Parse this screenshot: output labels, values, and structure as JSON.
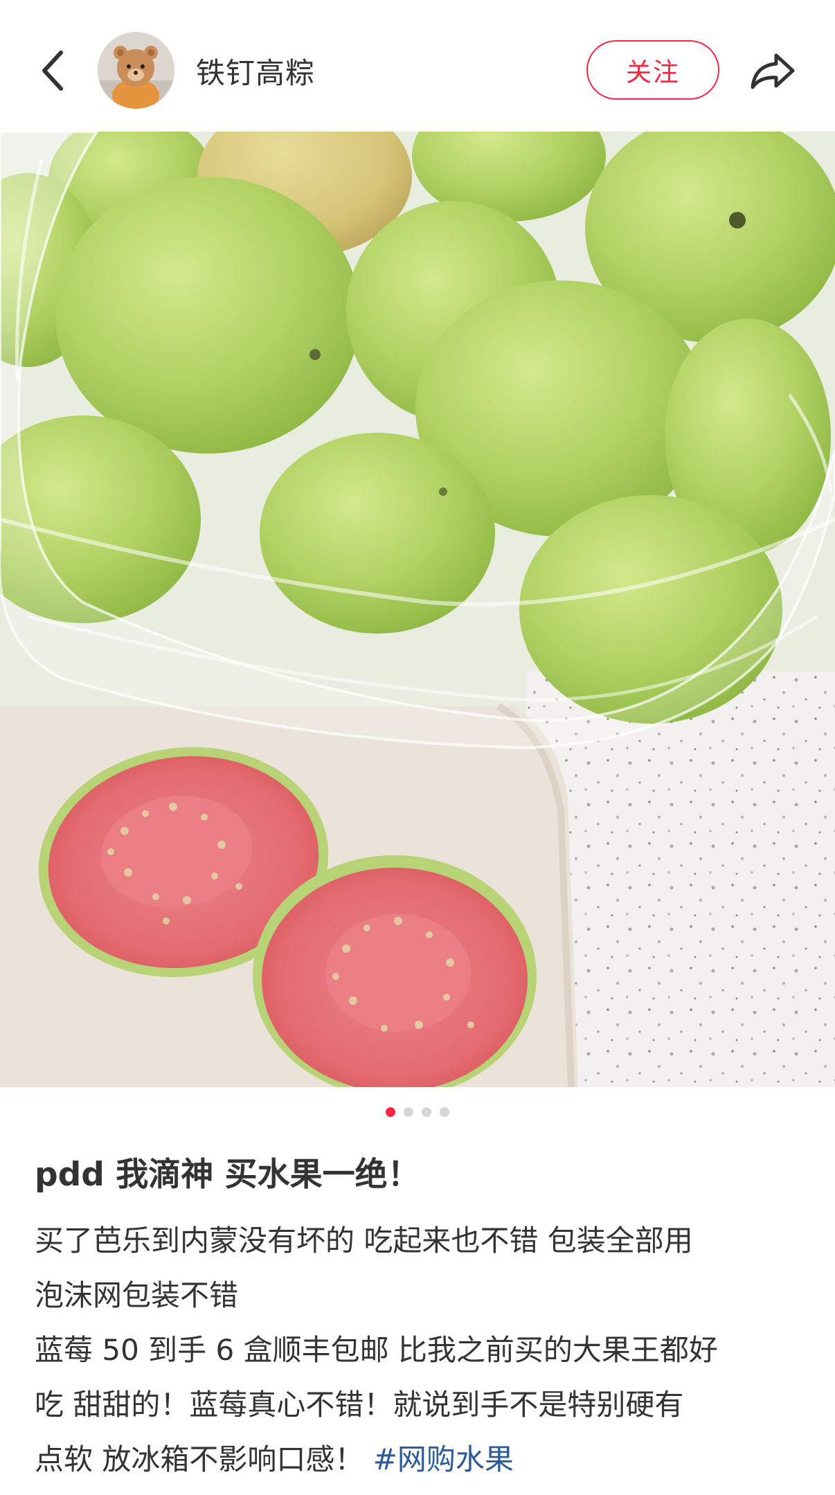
{
  "header": {
    "username": "铁钉高粽",
    "follow_label": "关注",
    "back_icon": "chevron-left-icon",
    "share_icon": "share-icon"
  },
  "carousel": {
    "total": 4,
    "active_index": 0
  },
  "post": {
    "title": "pdd 我滴神 买水果一绝！",
    "lines": [
      "买了芭乐到内蒙没有坏的 吃起来也不错 包装全部用",
      "泡沫网包装不错",
      "蓝莓 50 到手 6 盒顺丰包邮 比我之前买的大果王都好",
      "吃 甜甜的！蓝莓真心不错！就说到手不是特别硬有"
    ],
    "last_line_text": "点软 放冰箱不影响口感！ ",
    "hashtag": "#网购水果"
  },
  "colors": {
    "accent": "#ff2442",
    "hashtag": "#2b5b9c",
    "text": "#333333",
    "guava_skin": "#b7d66a",
    "guava_flesh": "#e86a6f"
  }
}
